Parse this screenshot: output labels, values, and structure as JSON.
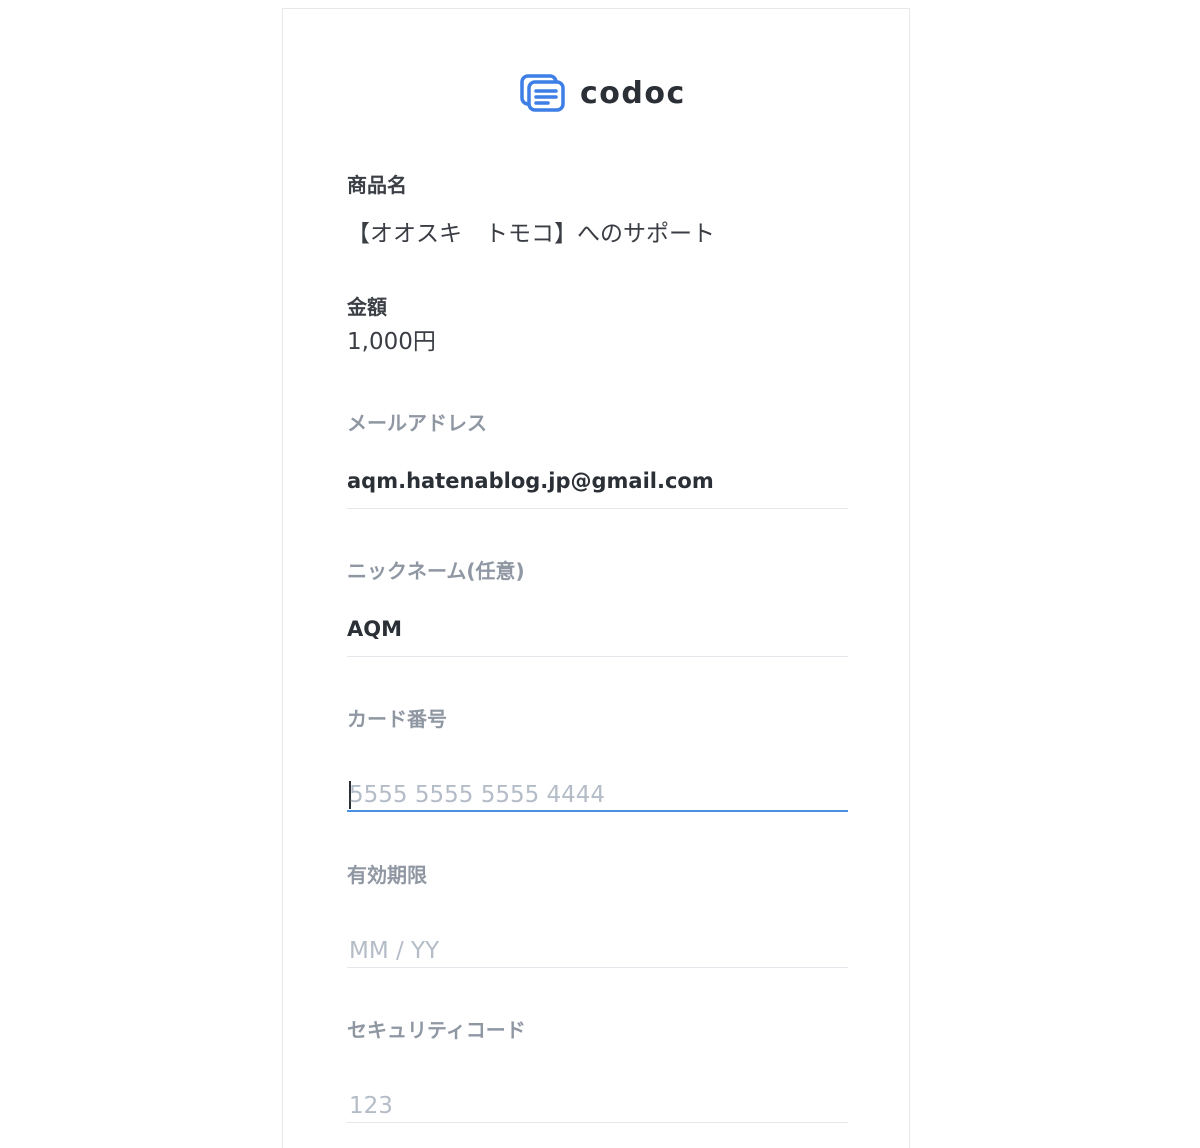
{
  "brand": {
    "name": "codoc",
    "logo_color": "#3d7fe6"
  },
  "product": {
    "label": "商品名",
    "value": "【オオスキ　トモコ】へのサポート"
  },
  "amount": {
    "label": "金額",
    "value": "1,000円"
  },
  "email": {
    "label": "メールアドレス",
    "value": "aqm.hatenablog.jp@gmail.com"
  },
  "nickname": {
    "label": "ニックネーム(任意)",
    "value": "AQM"
  },
  "card_number": {
    "label": "カード番号",
    "placeholder": "5555 5555 5555 4444",
    "focused": true
  },
  "expiry": {
    "label": "有効期限",
    "placeholder": "MM / YY"
  },
  "cvc": {
    "label": "セキュリティコード",
    "placeholder": "123"
  },
  "colors": {
    "focus_underline": "#4a90e2",
    "label_muted": "#8f97a3",
    "placeholder": "#b4bcc7"
  }
}
